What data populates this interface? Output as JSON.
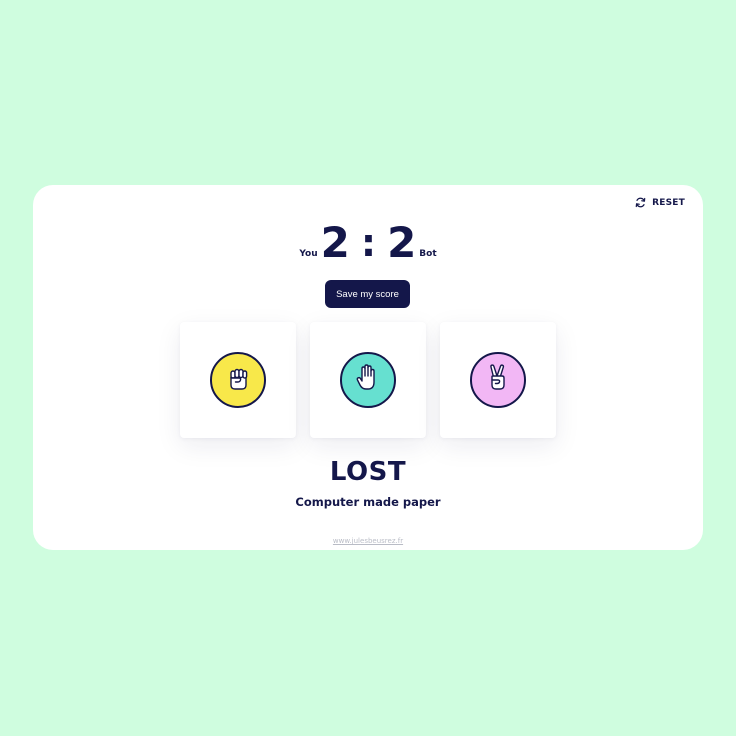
{
  "header": {
    "reset_label": "RESET",
    "reset_icon": "refresh-icon"
  },
  "score": {
    "you_label": "You",
    "you_score": "2",
    "separator": ":",
    "bot_score": "2",
    "bot_label": "Bot"
  },
  "save_button_label": "Save my score",
  "choices": [
    {
      "icon": "rock-fist-icon",
      "color": "#f8e84a"
    },
    {
      "icon": "paper-hand-icon",
      "color": "#66e0d0"
    },
    {
      "icon": "scissors-hand-icon",
      "color": "#f2b7f5"
    }
  ],
  "result": {
    "title": "LOST",
    "message": "Computer made paper"
  },
  "footer": {
    "link_text": "www.julesbeusrez.fr"
  },
  "colors": {
    "background": "#cffddf",
    "card": "#ffffff",
    "primary": "#14174a"
  }
}
